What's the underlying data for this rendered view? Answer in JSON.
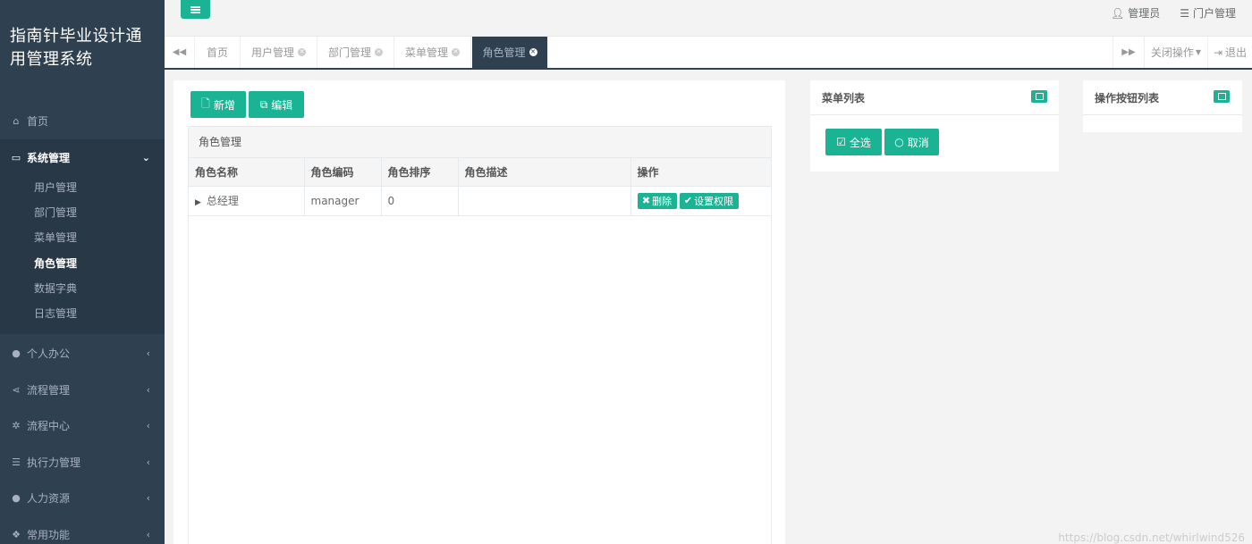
{
  "app": {
    "title": "指南针毕业设计通用管理系统"
  },
  "sidebar": {
    "home": "首页",
    "group_active": {
      "label": "系统管理"
    },
    "sub_items": [
      {
        "label": "用户管理"
      },
      {
        "label": "部门管理"
      },
      {
        "label": "菜单管理"
      },
      {
        "label": "角色管理"
      },
      {
        "label": "数据字典"
      },
      {
        "label": "日志管理"
      }
    ],
    "groups": [
      {
        "label": "个人办公",
        "icon": "user-icon"
      },
      {
        "label": "流程管理",
        "icon": "share-icon"
      },
      {
        "label": "流程中心",
        "icon": "gear-icon"
      },
      {
        "label": "执行力管理",
        "icon": "list-icon"
      },
      {
        "label": "人力资源",
        "icon": "user-plus-icon"
      },
      {
        "label": "常用功能",
        "icon": "cubes-icon"
      }
    ]
  },
  "topbar": {
    "admin": "管理员",
    "portal": "门户管理"
  },
  "tabs": {
    "items": [
      {
        "label": "首页"
      },
      {
        "label": "用户管理"
      },
      {
        "label": "部门管理"
      },
      {
        "label": "菜单管理"
      },
      {
        "label": "角色管理"
      }
    ],
    "close_ops": "关闭操作",
    "logout": "退出"
  },
  "roles": {
    "add_label": "新增",
    "edit_label": "编辑",
    "caption": "角色管理",
    "columns": [
      "角色名称",
      "角色编码",
      "角色排序",
      "角色描述",
      "操作"
    ],
    "rows": [
      {
        "name": "总经理",
        "code": "manager",
        "order": "0",
        "desc": "",
        "delete": "删除",
        "perm": "设置权限"
      }
    ]
  },
  "menu_panel": {
    "title": "菜单列表",
    "select_all": "全选",
    "cancel": "取消"
  },
  "button_panel": {
    "title": "操作按钮列表"
  },
  "watermark": "https://blog.csdn.net/whirlwind526",
  "colors": {
    "sidebar": "#2f4050",
    "accent": "#1ab394"
  }
}
